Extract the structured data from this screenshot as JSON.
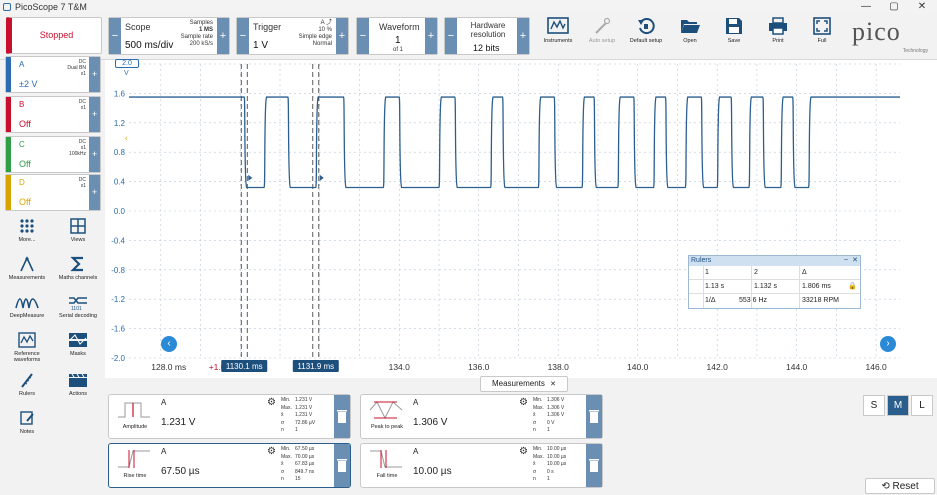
{
  "window": {
    "title": "PicoScope 7 T&M",
    "min": "—",
    "max": "▢",
    "close": "✕"
  },
  "run_state": "Stopped",
  "scope_ctrl": {
    "name": "Scope",
    "value": "500 ms/div",
    "samples_label": "Samples",
    "samples": "1 MS",
    "rate_label": "Sample rate",
    "rate": "200 kS/s"
  },
  "trigger_ctrl": {
    "name": "Trigger",
    "channel": "A",
    "value": "1 V",
    "percent": "10 %",
    "mode": "Simple edge",
    "submode": "Normal"
  },
  "waveform_ctrl": {
    "name": "Waveform",
    "value": "1",
    "of": "of 1"
  },
  "resolution_ctrl": {
    "name": "Hardware resolution",
    "value": "12 bits"
  },
  "toolbar_buttons": [
    "Instruments",
    "Auto setup",
    "Default setup",
    "Open",
    "Save",
    "Print",
    "Full"
  ],
  "logo": {
    "text": "pico",
    "sub": "Technology"
  },
  "channels": [
    {
      "letter": "A",
      "state": "±2 V",
      "coupling": "DC",
      "extra": "Dual BN",
      "probe": "x1",
      "color": "#2b6cb0"
    },
    {
      "letter": "B",
      "state": "Off",
      "coupling": "DC",
      "extra": "",
      "probe": "x1",
      "color": "#c8102e"
    },
    {
      "letter": "C",
      "state": "Off",
      "coupling": "DC",
      "extra": "x1",
      "probe": "100kHz",
      "color": "#2f9e44"
    },
    {
      "letter": "D",
      "state": "Off",
      "coupling": "DC",
      "extra": "",
      "probe": "x1",
      "color": "#d9a400"
    }
  ],
  "tools": [
    "More...",
    "Views",
    "Measurements",
    "Maths channels",
    "DeepMeasure",
    "Serial decoding",
    "Reference waveforms",
    "Masks",
    "Rulers",
    "Actions",
    "Notes"
  ],
  "chart_data": {
    "type": "line",
    "xlabel": "ms",
    "ylabel": "V",
    "xlim": [
      127.2,
      146.6
    ],
    "ylim": [
      -2.0,
      2.0
    ],
    "x_ticks": [
      "128.0 ms",
      "+1.0 s",
      "134.0",
      "136.0",
      "138.0",
      "140.0",
      "142.0",
      "144.0",
      "146.0"
    ],
    "y_ticks": [
      "2.0",
      "1.6",
      "1.2",
      "0.8",
      "0.4",
      "0.0",
      "-0.4",
      "-0.8",
      "-1.2",
      "-1.6",
      "-2.0"
    ],
    "high_level": 1.55,
    "low_level": 0.32,
    "pulses": [
      {
        "start": 130.1,
        "end": 130.6
      },
      {
        "start": 131.2,
        "end": 131.9
      },
      {
        "start": 132.6,
        "end": 133.6
      },
      {
        "start": 134.0,
        "end": 135.0
      },
      {
        "start": 135.4,
        "end": 136.3
      },
      {
        "start": 136.6,
        "end": 137.5
      },
      {
        "start": 137.9,
        "end": 138.6
      },
      {
        "start": 138.9,
        "end": 139.5
      },
      {
        "start": 139.9,
        "end": 140.4
      },
      {
        "start": 140.7,
        "end": 141.2
      },
      {
        "start": 141.6,
        "end": 142.0
      },
      {
        "start": 142.35,
        "end": 142.8
      },
      {
        "start": 143.15,
        "end": 143.6
      },
      {
        "start": 143.9,
        "end": 144.3
      }
    ],
    "grid": true,
    "rulers": {
      "r1": "1130.1 ms",
      "r2": "1131.9 ms"
    }
  },
  "rulers_panel": {
    "title": "Rulers",
    "header": [
      "1",
      "2",
      "Δ"
    ],
    "row1": [
      "1.13 s",
      "1.132 s",
      "1.806 ms"
    ],
    "row2": [
      "1/Δ",
      "553.6 Hz",
      "33218 RPM"
    ]
  },
  "measurements": {
    "tab": "Measurements",
    "cards": [
      {
        "channel": "A",
        "value": "1.231 V",
        "name": "Amplitude",
        "min": "1.231 V",
        "max": "1.231 V",
        "avg": "1.231 V",
        "sd": "72.86 µV",
        "n": "1"
      },
      {
        "channel": "A",
        "value": "1.306 V",
        "name": "Peak to peak",
        "min": "1.306 V",
        "max": "1.306 V",
        "avg": "1.306 V",
        "sd": "0 V",
        "n": "1"
      },
      {
        "channel": "A",
        "value": "67.50 µs",
        "name": "Rise time",
        "min": "67.50 µs",
        "max": "70.00 µs",
        "avg": "67.83 µs",
        "sd": "849.7 ns",
        "n": "15"
      },
      {
        "channel": "A",
        "value": "10.00 µs",
        "name": "Fall time",
        "min": "10.00 µs",
        "max": "10.00 µs",
        "avg": "10.00 µs",
        "sd": "0 s",
        "n": "1"
      }
    ],
    "stat_labels": [
      "Min.",
      "Max.",
      "x̄",
      "σ",
      "n"
    ]
  },
  "size_buttons": [
    "S",
    "M",
    "L"
  ],
  "reset_label": "Reset"
}
